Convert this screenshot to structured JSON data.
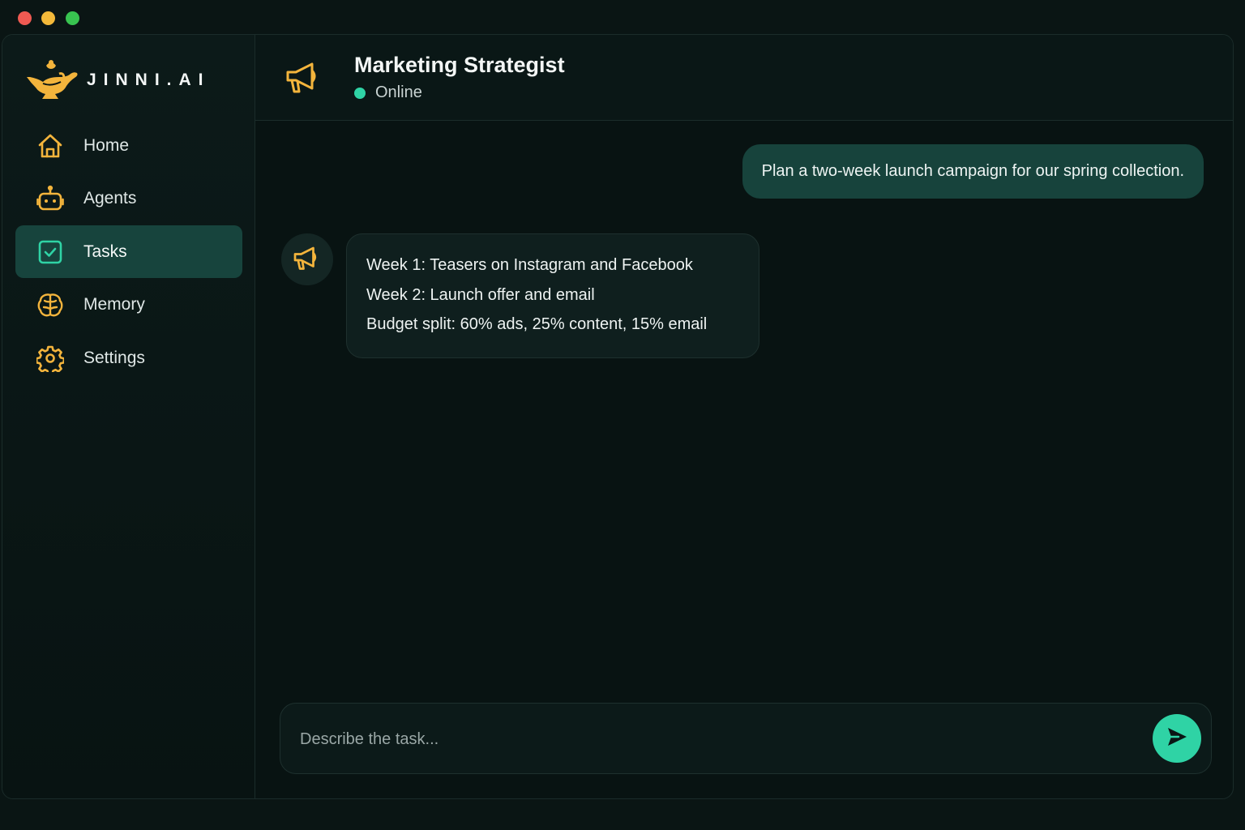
{
  "window": {
    "controls": [
      "close",
      "minimize",
      "maximize"
    ]
  },
  "brand": {
    "name": "JINNI.AI",
    "logo_icon": "genie-lamp-icon"
  },
  "sidebar": {
    "items": [
      {
        "label": "Home",
        "icon": "home-icon",
        "active": false
      },
      {
        "label": "Agents",
        "icon": "robot-icon",
        "active": false
      },
      {
        "label": "Tasks",
        "icon": "checkbox-icon",
        "active": true
      },
      {
        "label": "Memory",
        "icon": "brain-icon",
        "active": false
      },
      {
        "label": "Settings",
        "icon": "gear-icon",
        "active": false
      }
    ]
  },
  "header": {
    "agent_name": "Marketing Strategist",
    "status": "Online",
    "icon": "megaphone-icon"
  },
  "chat": {
    "messages": [
      {
        "role": "user",
        "text": "Plan a two-week launch campaign for our spring collection."
      },
      {
        "role": "agent",
        "lines": [
          "Week 1: Teasers on Instagram and Facebook",
          "Week 2: Launch offer and email",
          "Budget split: 60% ads, 25% content, 15% email"
        ]
      }
    ]
  },
  "composer": {
    "placeholder": "Describe the task...",
    "value": "",
    "send_icon": "send-icon"
  },
  "colors": {
    "background": "#081312",
    "accent": "#2fd3a5",
    "icon_gold": "#f3b43c",
    "active_item": "#17443d",
    "user_bubble": "#17433c",
    "agent_bubble": "#0f1f1e"
  }
}
